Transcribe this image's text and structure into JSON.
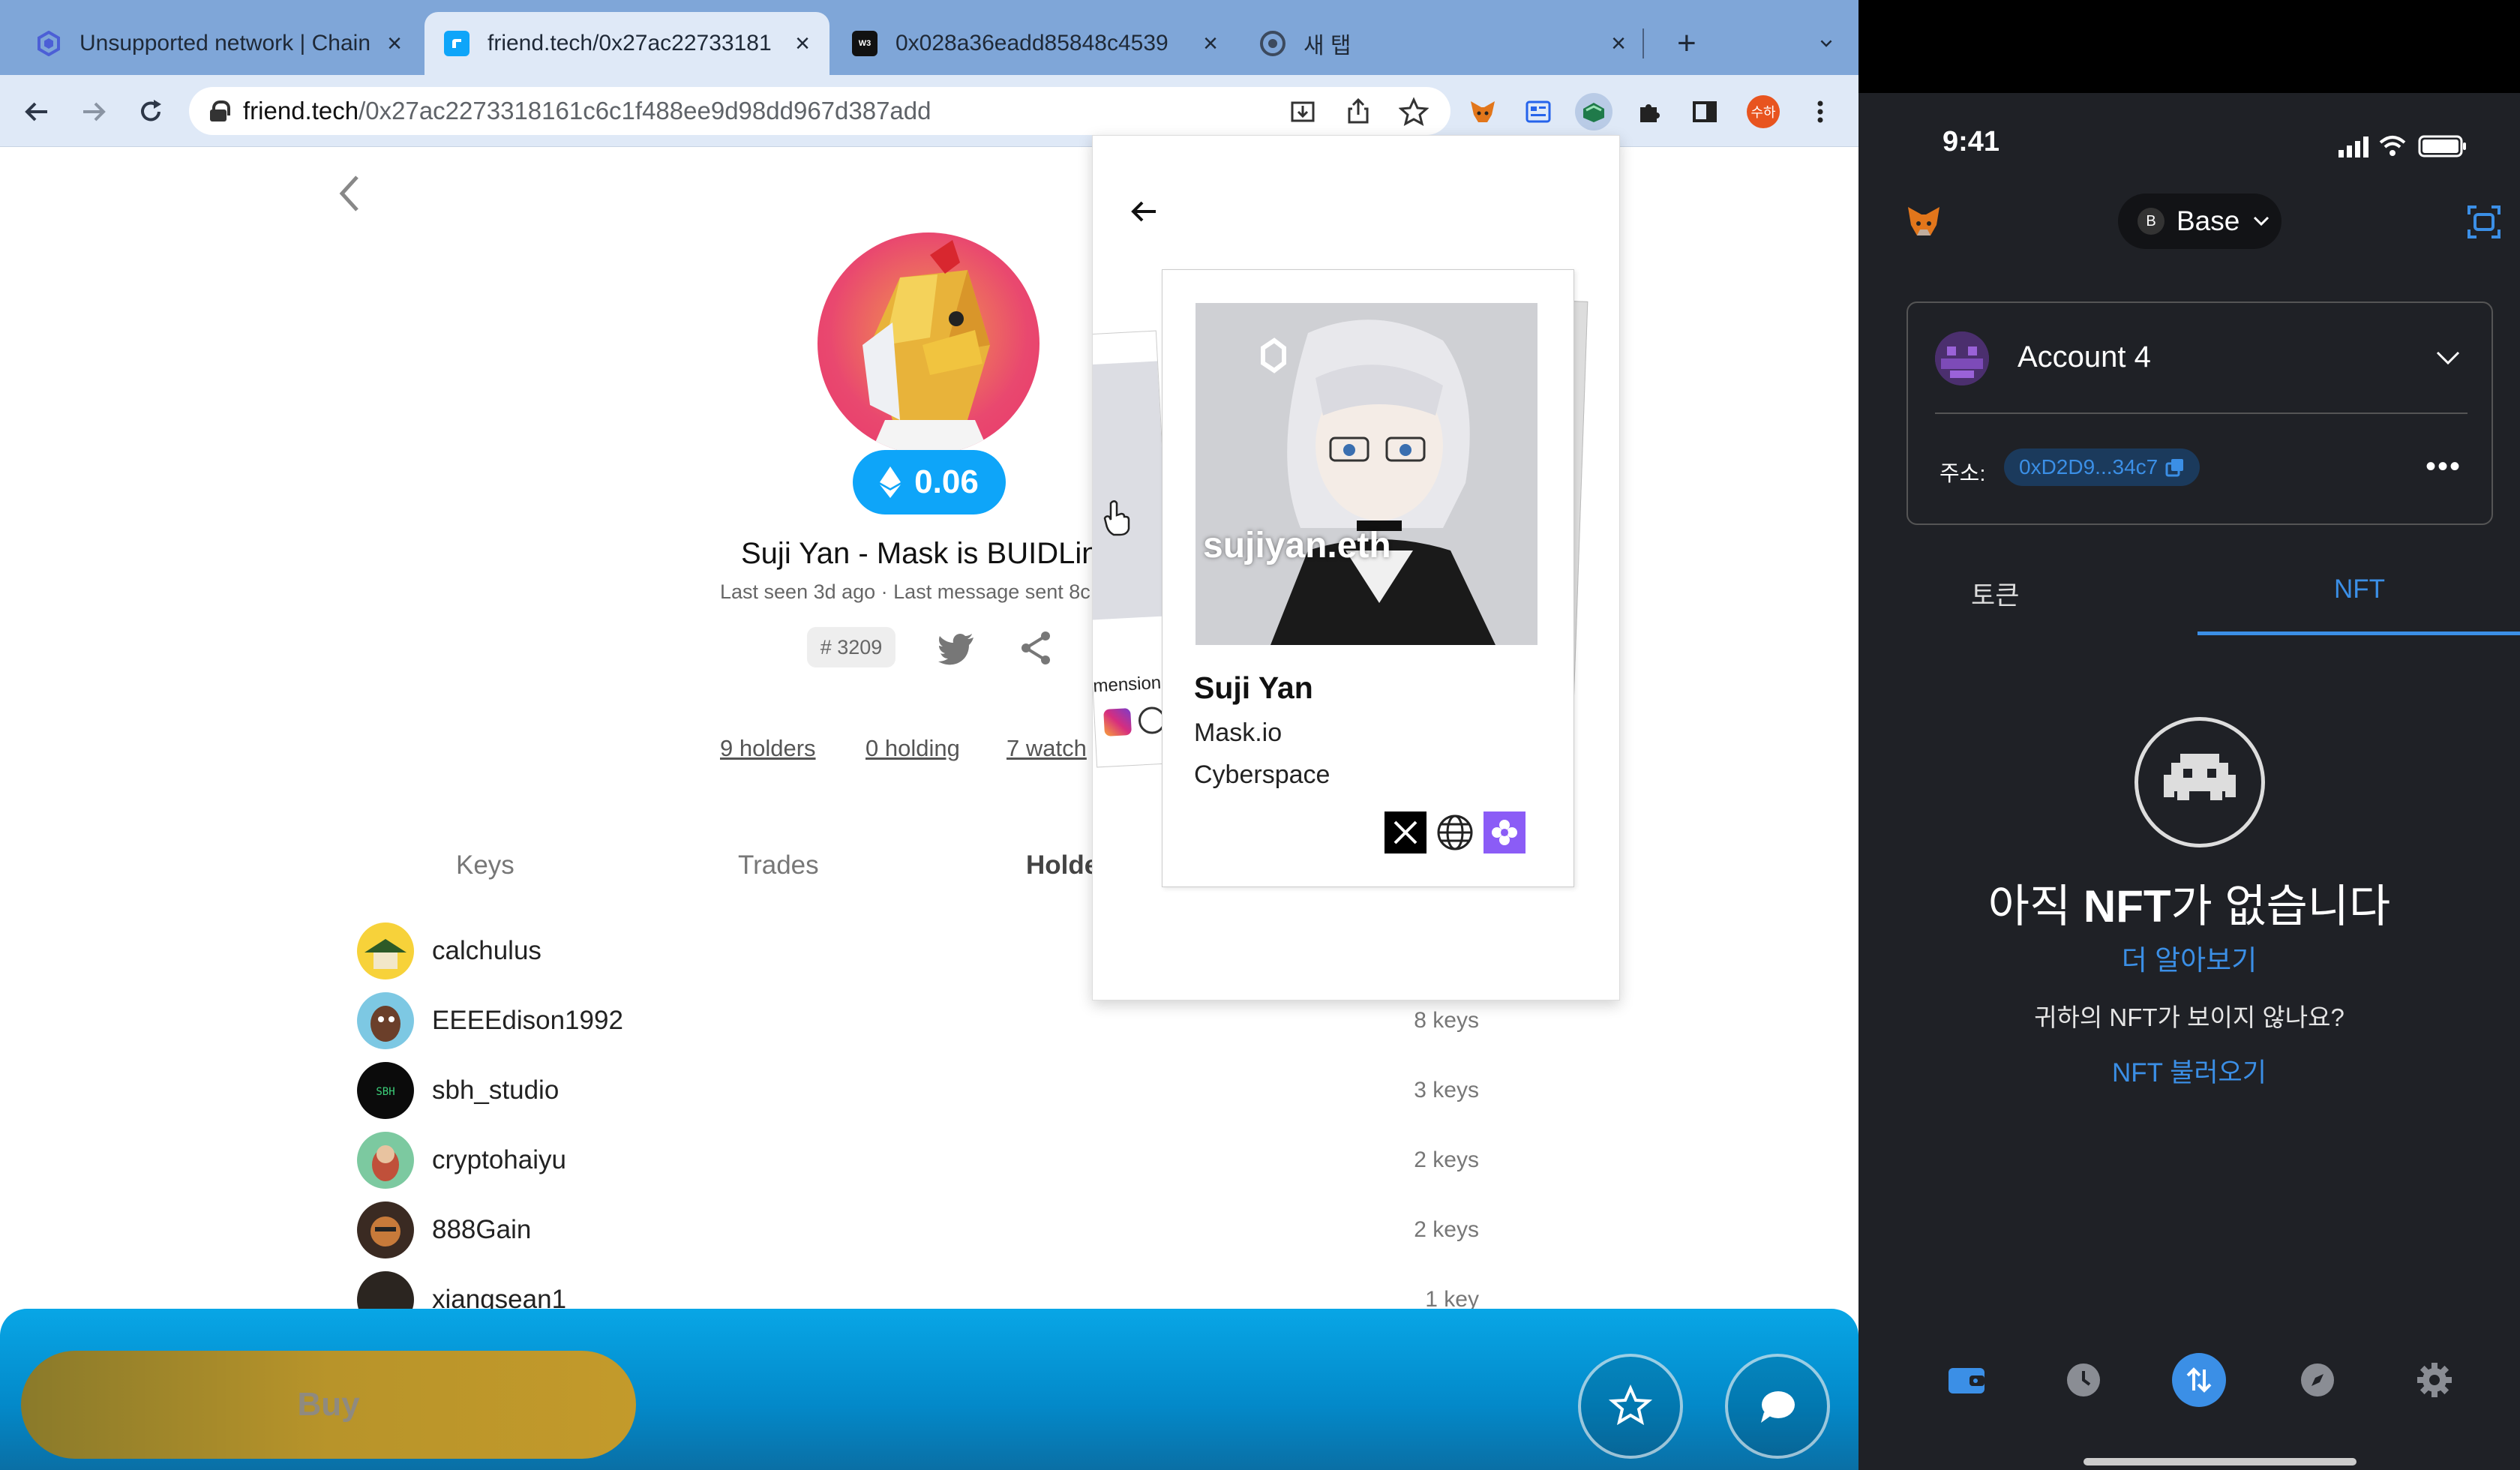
{
  "browser": {
    "tabs": [
      {
        "label": "Unsupported network | Chain",
        "favicon": "hexagon-icon",
        "active": false
      },
      {
        "label": "friend.tech/0x27ac22733181",
        "favicon": "friendtech-icon",
        "active": true
      },
      {
        "label": "0x028a36eadd85848c4539",
        "favicon": "web3bio-icon",
        "active": false
      },
      {
        "label": "새 탭",
        "favicon": "chrome-icon",
        "active": false
      }
    ],
    "new_tab": "+",
    "url_host": "friend.tech",
    "url_path": "/0x27ac2273318161c6c1f488ee9d98dd967d387add"
  },
  "profile": {
    "price": "0.06",
    "name": "Suji Yan - Mask is BUIDLin",
    "meta": "Last seen 3d ago · Last message sent 8c",
    "rank": "# 3209",
    "stats": {
      "holders": "9 holders",
      "holding": "0 holding",
      "watch": "7 watch"
    },
    "tabs": [
      "Keys",
      "Trades",
      "Holde"
    ],
    "holders": [
      {
        "name": "calchulus",
        "keys": ""
      },
      {
        "name": "EEEEdison1992",
        "keys": "8 keys"
      },
      {
        "name": "sbh_studio",
        "keys": "3 keys"
      },
      {
        "name": "cryptohaiyu",
        "keys": "2 keys"
      },
      {
        "name": "888Gain",
        "keys": "2 keys"
      },
      {
        "name": "xiangsean1",
        "keys": "1 key"
      }
    ],
    "buy_label": "Buy"
  },
  "popup": {
    "ens": "sujiyan.eth",
    "name": "Suji Yan",
    "org": "Mask.io",
    "location": "Cyberspace",
    "back_card_text": "mension"
  },
  "wallet": {
    "time": "9:41",
    "network_badge": "B",
    "network": "Base",
    "account": "Account 4",
    "address_label": "주소:",
    "address": "0xD2D9...34c7",
    "more": "•••",
    "tab_tokens": "토큰",
    "tab_nft": "NFT",
    "empty_title_pre": "아직 ",
    "empty_title_bold": "NFT",
    "empty_title_post": "가 없습니다",
    "learn_more": "더 알아보기",
    "no_nft_question": "귀하의 NFT가 보이지 않나요?",
    "import_nft": "NFT 불러오기"
  },
  "colors": {
    "accent_blue": "#0ea5f9",
    "metamask_blue": "#3b8fe6",
    "buy_gold": "#b8942a"
  }
}
